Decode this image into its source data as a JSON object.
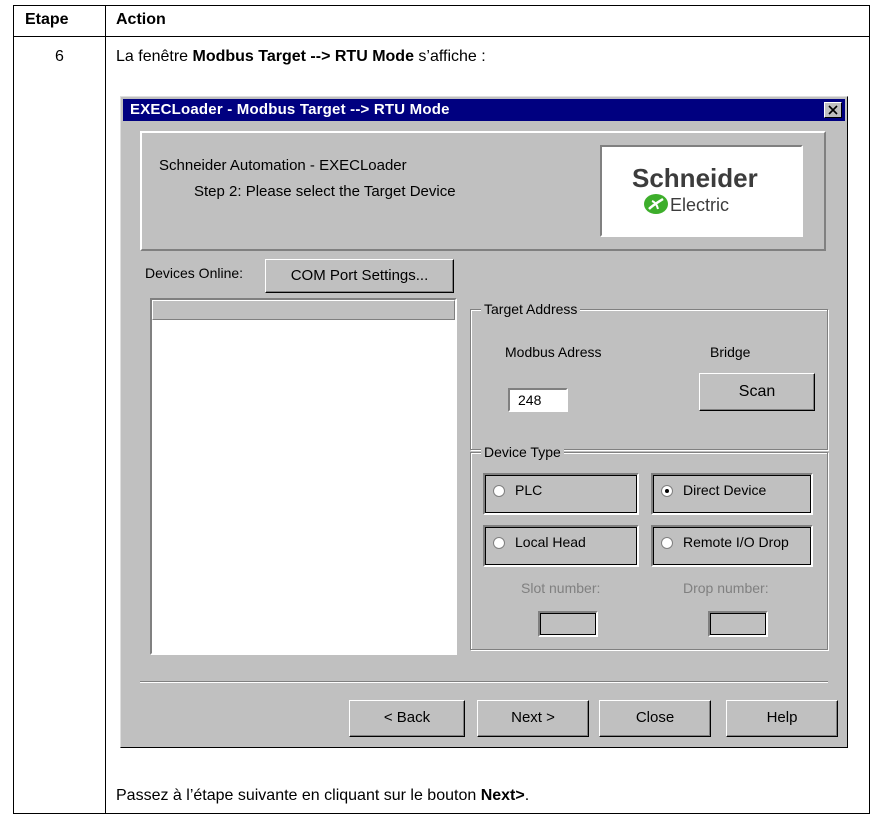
{
  "table": {
    "header_step": "Etape",
    "header_action": "Action",
    "step_number": "6",
    "intro_prefix": "La fenêtre ",
    "intro_bold": "Modbus Target --> RTU Mode",
    "intro_suffix": " s’affiche :",
    "outro_prefix": "Passez à l’étape suivante en cliquant sur le bouton ",
    "outro_bold": "Next>",
    "outro_suffix": "."
  },
  "dialog": {
    "title": "EXECLoader - Modbus Target --> RTU Mode",
    "header_line1": "Schneider Automation - EXECLoader",
    "header_line2": "Step 2: Please select the Target Device",
    "logo_name": "Schneider",
    "logo_sub": "Electric",
    "devices_online_label": "Devices Online:",
    "com_port_button": "COM Port Settings...",
    "target_address": {
      "title": "Target Address",
      "modbus_label": "Modbus Adress",
      "modbus_value": "248",
      "bridge_label": "Bridge",
      "scan_button": "Scan"
    },
    "device_type": {
      "title": "Device Type",
      "options": [
        {
          "label": "PLC",
          "selected": false
        },
        {
          "label": "Direct Device",
          "selected": true
        },
        {
          "label": "Local Head",
          "selected": false
        },
        {
          "label": "Remote I/O Drop",
          "selected": false
        }
      ],
      "slot_label": "Slot number:",
      "drop_label": "Drop number:"
    },
    "buttons": {
      "back": "< Back",
      "next": "Next >",
      "close": "Close",
      "help": "Help"
    }
  }
}
